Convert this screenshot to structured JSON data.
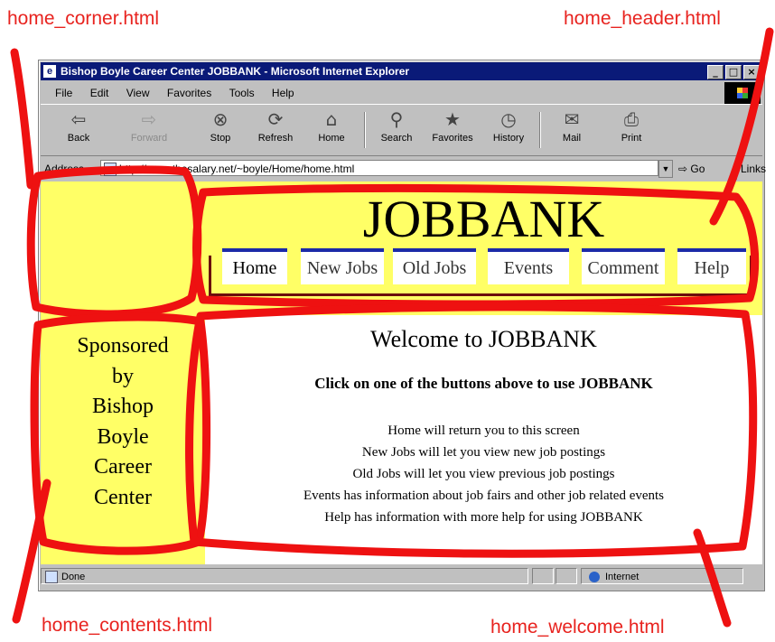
{
  "callouts": {
    "corner": "home_corner.html",
    "header": "home_header.html",
    "contents": "home_contents.html",
    "welcome": "home_welcome.html"
  },
  "browser": {
    "title": "Bishop Boyle Career Center JOBBANK - Microsoft Internet Explorer",
    "menu": [
      "File",
      "Edit",
      "View",
      "Favorites",
      "Tools",
      "Help"
    ],
    "toolbar": [
      {
        "label": "Back",
        "icon": "back-arrow-icon"
      },
      {
        "label": "Forward",
        "icon": "forward-arrow-icon"
      },
      {
        "label": "Stop",
        "icon": "stop-icon"
      },
      {
        "label": "Refresh",
        "icon": "refresh-icon"
      },
      {
        "label": "Home",
        "icon": "home-icon"
      },
      {
        "label": "Search",
        "icon": "search-icon"
      },
      {
        "label": "Favorites",
        "icon": "favorites-icon"
      },
      {
        "label": "History",
        "icon": "history-icon"
      },
      {
        "label": "Mail",
        "icon": "mail-icon"
      },
      {
        "label": "Print",
        "icon": "print-icon"
      }
    ],
    "address_label": "Address",
    "address_value": "http://www.thesalary.net/~boyle/Home/home.html",
    "go_label": "Go",
    "links_label": "Links",
    "status": "Done",
    "zone": "Internet"
  },
  "page": {
    "sponsor_lines": [
      "Sponsored",
      "by",
      "Bishop",
      "Boyle",
      "Career",
      "Center"
    ],
    "header_title": "JOBBANK",
    "nav": [
      "Home",
      "New Jobs",
      "Old Jobs",
      "Events",
      "Comment",
      "Help"
    ],
    "welcome_title": "Welcome to JOBBANK",
    "welcome_subtitle": "Click on one of the buttons above to use JOBBANK",
    "welcome_lines": [
      "Home will return you to this screen",
      "New Jobs will let you view new job postings",
      "Old Jobs will let you view previous job postings",
      "Events has information about job fairs and other job related events",
      "Help has information with more help for using JOBBANK"
    ]
  },
  "colors": {
    "annotation": "#ee1111",
    "callout_text": "#e8231f",
    "frame_yellow": "#ffff66",
    "nav_bar_blue": "#1b2aa8",
    "titlebar": "#0a1a78"
  }
}
